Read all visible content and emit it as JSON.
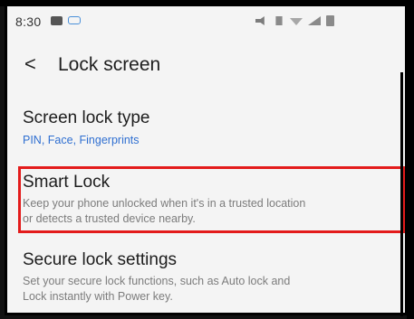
{
  "status_bar": {
    "time": "8:30",
    "icons": [
      "image-icon",
      "chat-icon",
      "mute-icon",
      "vibrate-icon",
      "wifi-icon",
      "signal-icon",
      "battery-icon"
    ]
  },
  "app_bar": {
    "back_label": "<",
    "title": "Lock screen"
  },
  "items": [
    {
      "title": "Screen lock type",
      "subtitle": "PIN, Face, Fingerprints"
    },
    {
      "title": "Smart Lock",
      "subtitle_line1": "Keep your phone unlocked when it's in a trusted location",
      "subtitle_line2": "or detects a trusted device nearby."
    },
    {
      "title": "Secure lock settings",
      "subtitle_line1": "Set your secure lock functions, such as Auto lock and",
      "subtitle_line2": "Lock instantly with Power key."
    }
  ],
  "colors": {
    "accent": "#2f6fd1",
    "highlight": "#e31b1b",
    "background": "#f4f4f4"
  }
}
